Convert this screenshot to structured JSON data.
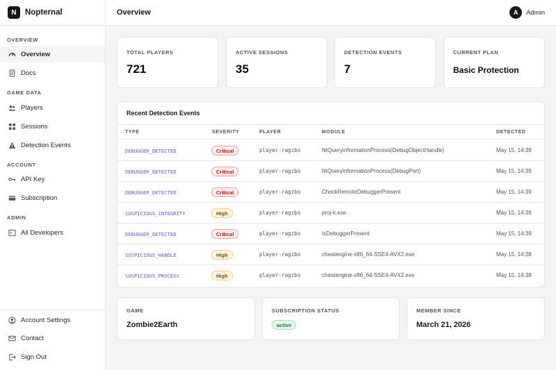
{
  "brand": {
    "logo_letter": "N",
    "name": "Nopternal"
  },
  "header": {
    "title": "Overview",
    "user_initial": "A",
    "user_name": "Admin"
  },
  "sidebar": {
    "sections": {
      "overview": "OVERVIEW",
      "game_data": "GAME DATA",
      "account": "ACCOUNT",
      "admin": "ADMIN"
    },
    "items": {
      "overview": "Overview",
      "docs": "Docs",
      "players": "Players",
      "sessions": "Sessions",
      "detection_events": "Detection Events",
      "api_key": "API Key",
      "subscription": "Subscription",
      "all_developers": "All Developers",
      "account_settings": "Account Settings",
      "contact": "Contact",
      "sign_out": "Sign Out"
    }
  },
  "stats": {
    "total_players": {
      "label": "TOTAL PLAYERS",
      "value": "721"
    },
    "active_sessions": {
      "label": "ACTIVE SESSIONS",
      "value": "35"
    },
    "detection_events": {
      "label": "DETECTION EVENTS",
      "value": "7"
    },
    "current_plan": {
      "label": "CURRENT PLAN",
      "value": "Basic Protection"
    }
  },
  "events": {
    "title": "Recent Detection Events",
    "columns": {
      "type": "TYPE",
      "severity": "SEVERITY",
      "player": "PLAYER",
      "module": "MODULE",
      "detected": "DETECTED"
    },
    "rows": [
      {
        "type": "DEBUGGER_DETECTED",
        "severity": "Critical",
        "player": "player-ragzbo",
        "module": "NtQueryInformationProcess(DebugObjectHandle)",
        "detected": "May 15, 14:39"
      },
      {
        "type": "DEBUGGER_DETECTED",
        "severity": "Critical",
        "player": "player-ragzbo",
        "module": "NtQueryInformationProcess(DebugPort)",
        "detected": "May 15, 14:39"
      },
      {
        "type": "DEBUGGER_DETECTED",
        "severity": "Critical",
        "player": "player-ragzbo",
        "module": "CheckRemoteDebuggerPresent",
        "detected": "May 15, 14:39"
      },
      {
        "type": "SUSPICIOUS_INTEGRITY",
        "severity": "High",
        "player": "player-ragzbo",
        "module": "proj-k.exe",
        "detected": "May 15, 14:39"
      },
      {
        "type": "DEBUGGER_DETECTED",
        "severity": "Critical",
        "player": "player-ragzbo",
        "module": "IsDebuggerPresent",
        "detected": "May 15, 14:39"
      },
      {
        "type": "SUSPICIOUS_HANDLE",
        "severity": "High",
        "player": "player-ragzbo",
        "module": "cheatengine-x86_64-SSE4-AVX2.exe",
        "detected": "May 15, 14:38"
      },
      {
        "type": "SUSPICIOUS_PROCESS",
        "severity": "High",
        "player": "player-ragzbo",
        "module": "cheatengine-x86_64-SSE4-AVX2.exe",
        "detected": "May 15, 14:38"
      }
    ]
  },
  "info": {
    "game": {
      "label": "GAME",
      "value": "Zombie2Earth"
    },
    "subscription_status": {
      "label": "SUBSCRIPTION STATUS",
      "value": "active"
    },
    "member_since": {
      "label": "MEMBER SINCE",
      "value": "March 21, 2026"
    }
  },
  "colors": {
    "critical": "#b91c1c",
    "high": "#92400e",
    "active": "#15803d",
    "type_link": "#5b63c9"
  }
}
